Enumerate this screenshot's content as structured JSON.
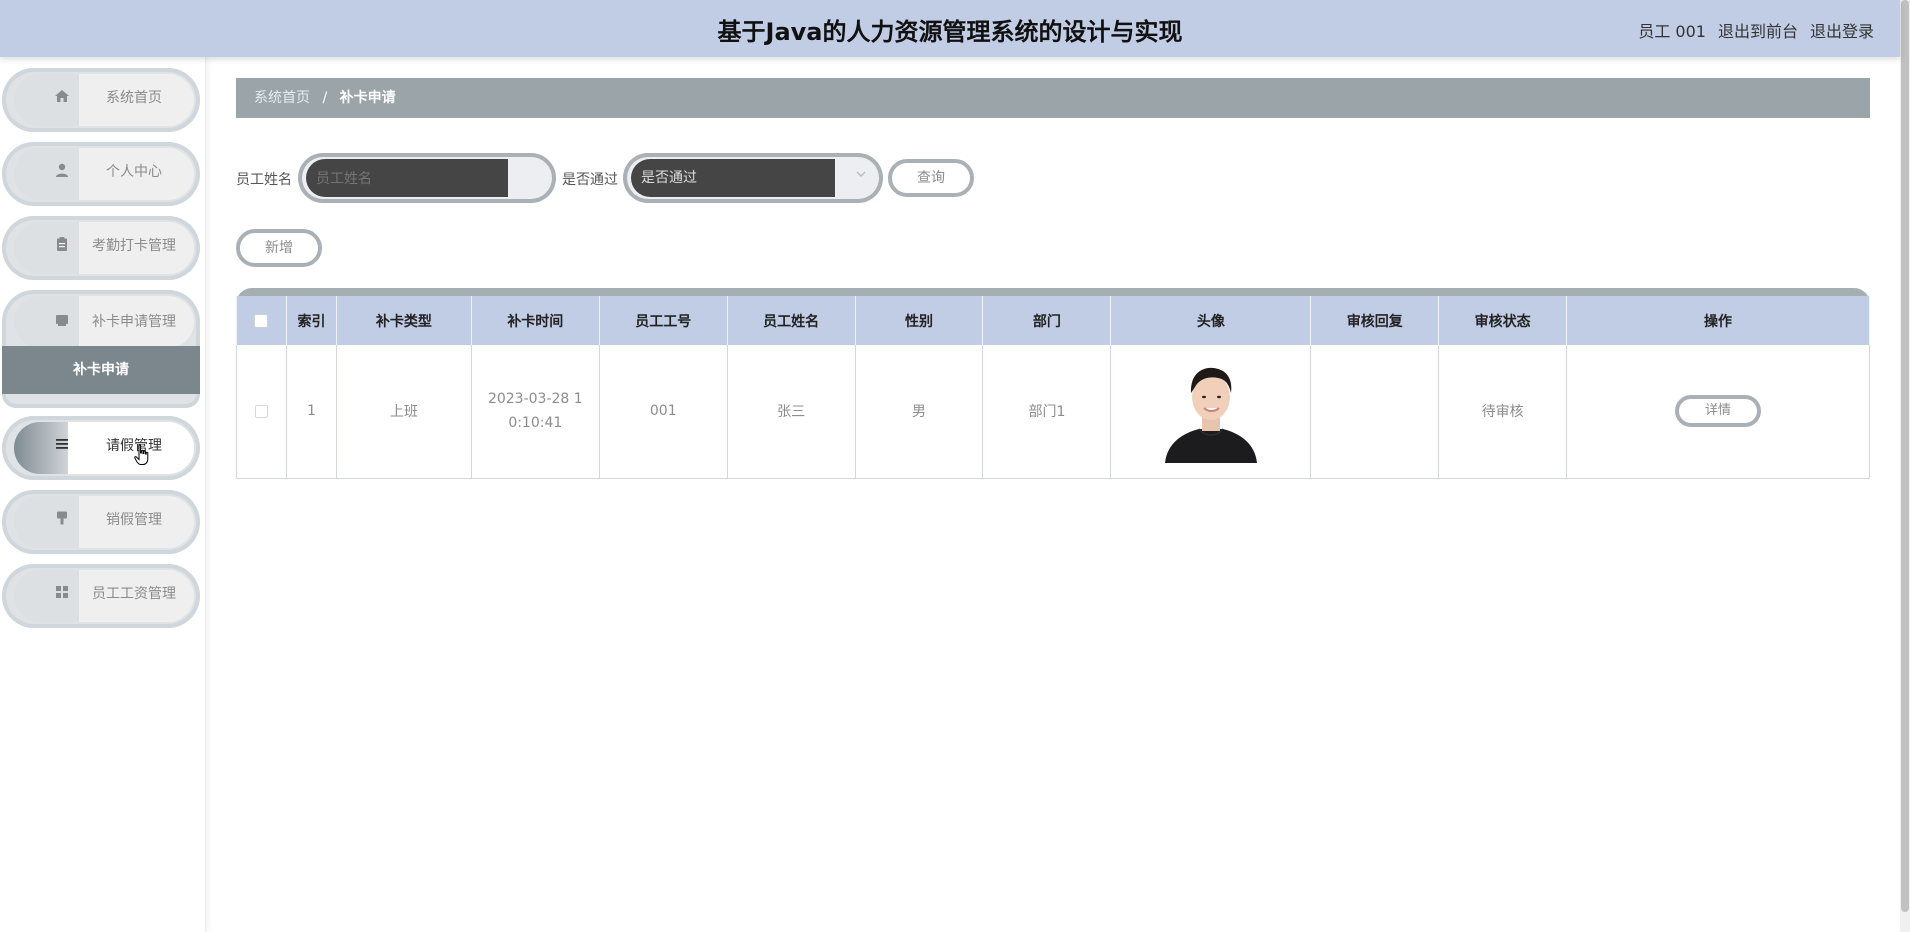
{
  "header": {
    "title": "基于Java的人力资源管理系统的设计与实现",
    "user_label": "员工 001",
    "to_front_label": "退出到前台",
    "logout_label": "退出登录"
  },
  "sidebar": {
    "items": [
      {
        "label": "系统首页",
        "icon": "home-icon"
      },
      {
        "label": "个人中心",
        "icon": "user-icon"
      },
      {
        "label": "考勤打卡管理",
        "icon": "clipboard-icon"
      },
      {
        "label": "补卡申请管理",
        "icon": "inbox-icon",
        "submenu": [
          {
            "label": "补卡申请"
          }
        ]
      },
      {
        "label": "请假管理",
        "icon": "list-icon"
      },
      {
        "label": "销假管理",
        "icon": "brush-icon"
      },
      {
        "label": "员工工资管理",
        "icon": "grid-icon"
      }
    ]
  },
  "breadcrumb": {
    "home": "系统首页",
    "separator": "/",
    "current": "补卡申请"
  },
  "filters": {
    "name_label": "员工姓名",
    "name_placeholder": "员工姓名",
    "pass_label": "是否通过",
    "pass_placeholder": "是否通过",
    "query_label": "查询"
  },
  "actions": {
    "add_label": "新增"
  },
  "table": {
    "columns": [
      "索引",
      "补卡类型",
      "补卡时间",
      "员工工号",
      "员工姓名",
      "性别",
      "部门",
      "头像",
      "审核回复",
      "审核状态",
      "操作"
    ],
    "rows": [
      {
        "index": "1",
        "type": "上班",
        "time": "2023-03-28 10:10:41",
        "emp_no": "001",
        "emp_name": "张三",
        "gender": "男",
        "dept": "部门1",
        "reply": "",
        "status": "待审核",
        "action_label": "详情"
      }
    ]
  },
  "colors": {
    "header_bg": "#c1cce5",
    "breadcrumb_bg": "#9aa4a9",
    "submenu_active_bg": "#7c878d"
  }
}
